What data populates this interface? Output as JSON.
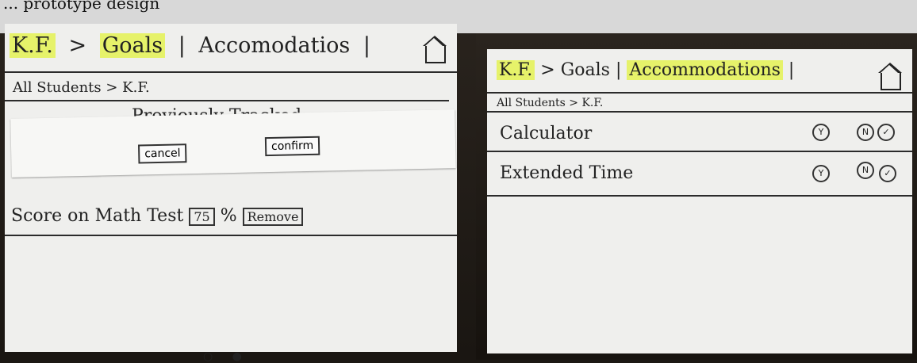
{
  "caption": "... prototype design",
  "left": {
    "nav": {
      "student": "K.F.",
      "goals": "Goals",
      "accommodations": "Accomodatios"
    },
    "breadcrumb": "All Students > K.F.",
    "previously_tracked": "Previously Tracked",
    "buttons": {
      "cancel": "cancel",
      "confirm": "confirm"
    },
    "score": {
      "label": "Score on Math Test",
      "value": "75",
      "unit": "%",
      "remove": "Remove"
    },
    "pagination": {
      "dots": "○ ●"
    }
  },
  "right": {
    "nav": {
      "student": "K.F.",
      "goals": "Goals",
      "accommodations": "Accommodations"
    },
    "breadcrumb": "All Students > K.F.",
    "rows": [
      {
        "label": "Calculator",
        "yes": "Y",
        "no": "N",
        "check": "✓"
      },
      {
        "label": "Extended Time",
        "yes": "Y",
        "no": "N",
        "check": "✓"
      }
    ]
  }
}
